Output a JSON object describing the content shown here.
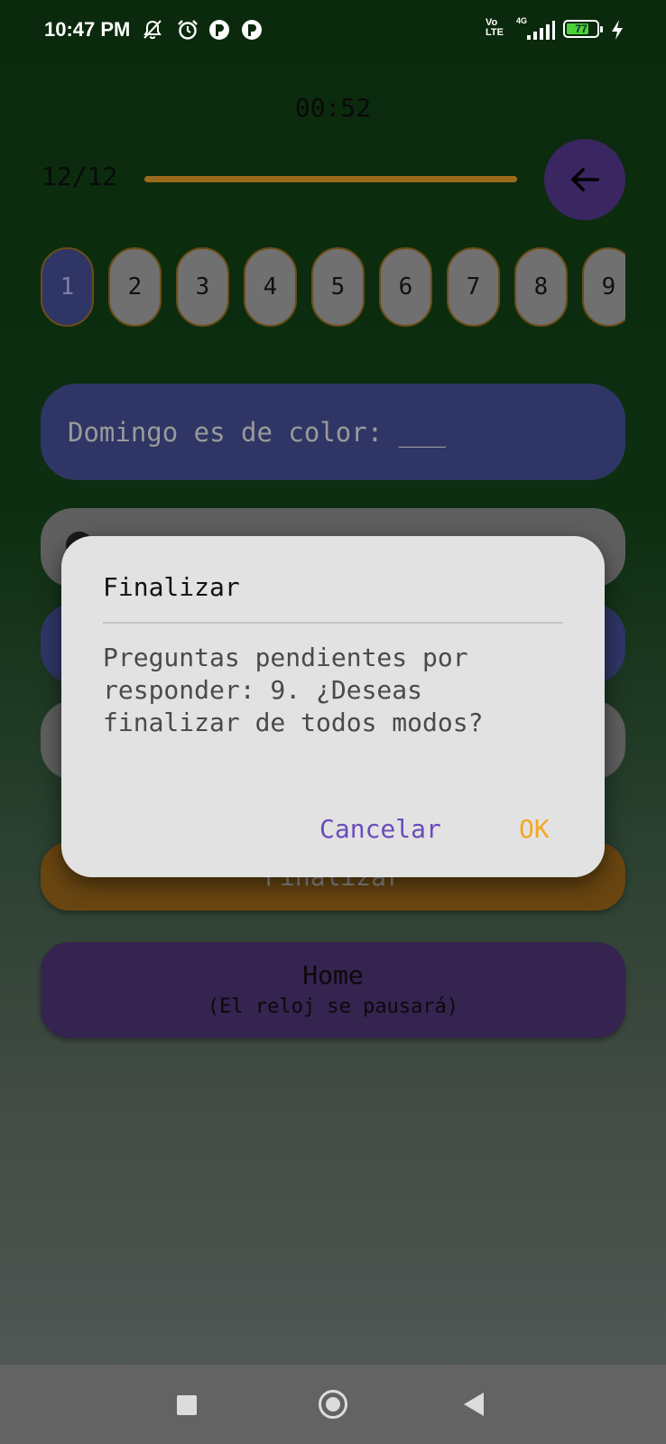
{
  "status_bar": {
    "time": "10:47 PM",
    "network_label": "Vo\nLTE",
    "network_gen": "4G",
    "battery": "77",
    "battery_level": 0.77,
    "icons": [
      "mute-icon",
      "alarm-icon",
      "app-notification-icon",
      "app-notification-icon",
      "signal-icon",
      "battery-icon",
      "charging-icon"
    ]
  },
  "quiz": {
    "timer": "00:52",
    "counter": "12/12",
    "progress": 1.0,
    "back_icon": "arrow-left-icon",
    "question_numbers": [
      "1",
      "2",
      "3",
      "4",
      "5",
      "6",
      "7",
      "8",
      "9"
    ],
    "active_question": "1",
    "question_text": "Domingo es de color: ___",
    "finish_label": "Finalizar",
    "home_label": "Home",
    "home_sublabel": "(El reloj se pausará)"
  },
  "dialog": {
    "title": "Finalizar",
    "message": "Preguntas pendientes por responder: 9. ¿Deseas finalizar de todos modos?",
    "cancel_label": "Cancelar",
    "ok_label": "OK"
  },
  "nav_bar": {
    "icons": [
      "recents-icon",
      "home-icon",
      "back-icon"
    ]
  },
  "colors": {
    "accent_purple": "#6a4bbb",
    "accent_orange": "#f5a623",
    "active_blue": "#2f3666"
  }
}
